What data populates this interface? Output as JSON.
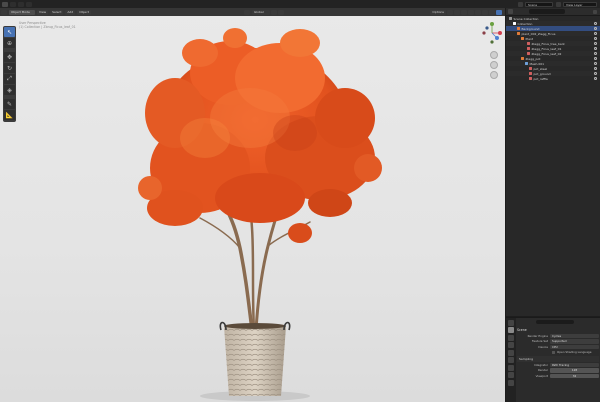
{
  "topbar": {
    "tabs": [
      "",
      "",
      "",
      "",
      "",
      "",
      ""
    ],
    "scene_label": "Scene",
    "view_layer_label": "View Layer"
  },
  "viewport": {
    "mode": "Object Mode",
    "menus": [
      "View",
      "Select",
      "Add",
      "Object"
    ],
    "transform_orientation": "Global",
    "options_label": "Options",
    "info_lines": [
      "User Perspective",
      "(1) Collection | Zbrug_Ficus_leaf_01",
      ""
    ]
  },
  "outliner": {
    "title": "Scene Collection",
    "rows": [
      {
        "label": "Scene Collection",
        "indent": 0,
        "icon_color": "#9a9a9a"
      },
      {
        "label": "Collection",
        "indent": 4,
        "icon_color": "#ffffff"
      },
      {
        "label": "Background",
        "indent": 8,
        "icon_color": "#e07b39",
        "selected": true
      },
      {
        "label": "plant_002_Ziegg_Ficus",
        "indent": 8,
        "icon_color": "#e07b39"
      },
      {
        "label": "Plant",
        "indent": 12,
        "icon_color": "#e07b39"
      },
      {
        "label": "Ziegg_Ficus_tree_bark",
        "indent": 18,
        "icon_color": "#d06060"
      },
      {
        "label": "Ziegg_Ficus_leaf_01",
        "indent": 18,
        "icon_color": "#d06060"
      },
      {
        "label": "Ziegg_Ficus_leaf_02",
        "indent": 18,
        "icon_color": "#d06060"
      },
      {
        "label": "Ziegg_pot",
        "indent": 12,
        "icon_color": "#e07b39"
      },
      {
        "label": "Mesh.001",
        "indent": 16,
        "icon_color": "#6fa0d8"
      },
      {
        "label": "pot_steel",
        "indent": 20,
        "icon_color": "#d06060"
      },
      {
        "label": "pot_ground",
        "indent": 20,
        "icon_color": "#d06060"
      },
      {
        "label": "pot_raffia",
        "indent": 20,
        "icon_color": "#d06060"
      }
    ]
  },
  "properties": {
    "header": "Scene",
    "render_engine_label": "Render Engine",
    "render_engine_value": "Cycles",
    "feature_set_label": "Feature Set",
    "feature_set_value": "Supported",
    "device_label": "Device",
    "device_value": "CPU",
    "osl_label": "Open Shading Language",
    "sampling_header": "Sampling",
    "integrator_label": "Integrator",
    "integrator_value": "Path Tracing",
    "render_samples_label": "Render",
    "render_samples_value": "128",
    "viewport_samples_label": "Viewport",
    "viewport_samples_value": "32"
  }
}
